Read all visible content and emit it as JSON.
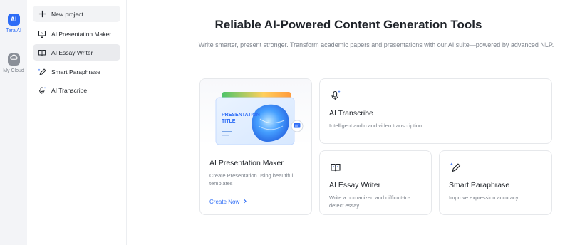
{
  "rail": {
    "logo_badge": "AI",
    "logo_label": "Tera AI",
    "cloud_label": "My Cloud"
  },
  "sidebar": {
    "items": [
      {
        "label": "New project",
        "icon": "plus-icon"
      },
      {
        "label": "AI Presentation Maker",
        "icon": "presentation-icon"
      },
      {
        "label": "AI Essay Writer",
        "icon": "book-ai-icon",
        "active": true
      },
      {
        "label": "Smart Paraphrase",
        "icon": "pen-sparkle-icon"
      },
      {
        "label": "AI Transcribe",
        "icon": "mic-sparkle-icon"
      }
    ]
  },
  "main": {
    "title": "Reliable AI-Powered Content Generation Tools",
    "subtitle": "Write smarter, present stronger. Transform academic papers and presentations with our AI suite—powered by advanced NLP."
  },
  "cards": {
    "presentation": {
      "slide_title": "PRESENTATION TITLE",
      "title": "AI Presentation Maker",
      "desc": "Create Presentation using beautiful templates",
      "cta": "Create Now"
    },
    "transcribe": {
      "title": "AI Transcribe",
      "desc": "Intelligent audio and video transcription."
    },
    "essay": {
      "title": "AI Essay Writer",
      "desc": "Write a humanized and difficult-to-detect essay"
    },
    "paraphrase": {
      "title": "Smart Paraphrase",
      "desc": "Improve expression accuracy"
    }
  },
  "colors": {
    "accent": "#2d6cf6",
    "text": "#1f2329",
    "muted": "#7d838c",
    "active_bg": "#eaebee"
  }
}
